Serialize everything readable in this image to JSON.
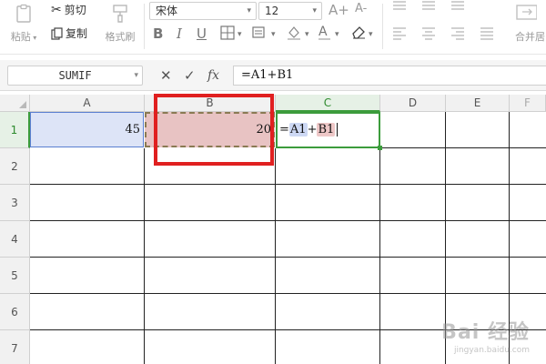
{
  "ribbon": {
    "paste_label": "粘贴",
    "cut_label": "剪切",
    "copy_label": "复制",
    "format_painter_label": "格式刷",
    "font_name": "宋体",
    "font_size": "12",
    "increase_font": "A+",
    "decrease_font": "A-",
    "merge_label": "合并居"
  },
  "formula_bar": {
    "name_box": "SUMIF",
    "cancel_icon": "✕",
    "confirm_icon": "✓",
    "fx_label": "fx",
    "formula": "=A1+B1"
  },
  "columns": [
    "A",
    "B",
    "C",
    "D",
    "E",
    "F"
  ],
  "rows": [
    "1",
    "2",
    "3",
    "4",
    "5",
    "6",
    "7"
  ],
  "cells": {
    "A1": "45",
    "B1": "20",
    "C1_formula": {
      "prefix": "=",
      "ref1": "A1",
      "op": "+",
      "ref2": "B1"
    }
  },
  "watermark": {
    "logo": "Bai 经验",
    "sub": "jingyan.baidu.com"
  },
  "colors": {
    "selection_green": "#3c9c3c",
    "ref_blue": "#dde4f7",
    "ref_red": "#e8c3c3",
    "highlight_red": "#e02020"
  }
}
